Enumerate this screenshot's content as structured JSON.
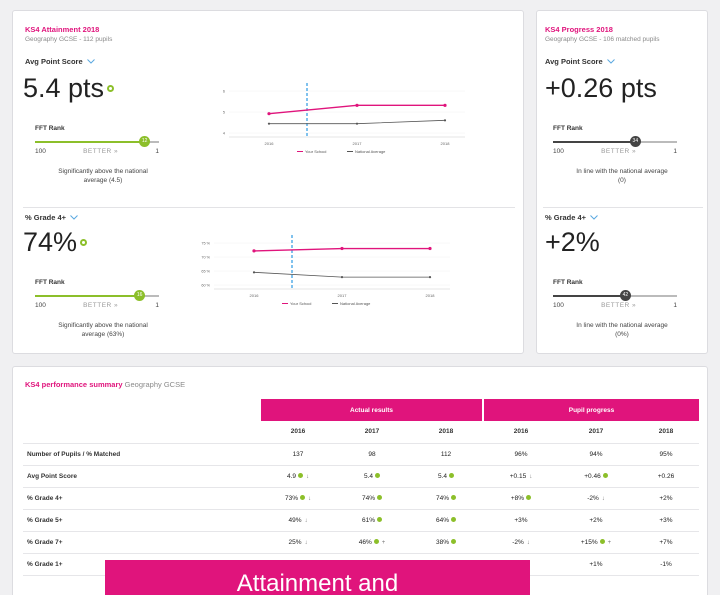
{
  "attainment": {
    "title": "KS4 Attainment 2018",
    "subtitle": "Geography GCSE - 112 pupils",
    "aps": {
      "label": "Avg Point Score",
      "value": "5.4 pts",
      "fft_label": "FFT Rank",
      "scale_left": "100",
      "scale_mid": "BETTER »",
      "scale_right": "1",
      "rank": "12",
      "rank_fraction": 0.88,
      "note_line1": "Significantly above the national",
      "note_line2": "average (4.5)"
    },
    "grade4": {
      "label": "% Grade 4+",
      "value": "74%",
      "fft_label": "FFT Rank",
      "scale_left": "100",
      "scale_mid": "BETTER »",
      "scale_right": "1",
      "rank": "16",
      "rank_fraction": 0.84,
      "note_line1": "Significantly above the national",
      "note_line2": "average (63%)"
    }
  },
  "progress": {
    "title": "KS4 Progress 2018",
    "subtitle": "Geography GCSE - 106 matched pupils",
    "aps": {
      "label": "Avg Point Score",
      "value": "+0.26 pts",
      "fft_label": "FFT Rank",
      "scale_left": "100",
      "scale_mid": "BETTER »",
      "scale_right": "1",
      "rank": "34",
      "rank_fraction": 0.66,
      "note_line1": "In line with the national average",
      "note_line2": "(0)"
    },
    "grade4": {
      "label": "% Grade 4+",
      "value": "+2%",
      "fft_label": "FFT Rank",
      "scale_left": "100",
      "scale_mid": "BETTER »",
      "scale_right": "1",
      "rank": "42",
      "rank_fraction": 0.58,
      "note_line1": "In line with the national average",
      "note_line2": "(0%)"
    }
  },
  "chart_data": [
    {
      "type": "line",
      "x": [
        "2016",
        "2017",
        "2018"
      ],
      "yticks": [
        "6",
        "5",
        "4"
      ],
      "ylim": [
        3.5,
        6.5
      ],
      "series": [
        {
          "name": "Your School",
          "values": [
            4.9,
            5.4,
            5.4
          ],
          "color": "#e0147c"
        },
        {
          "name": "National Average",
          "values": [
            4.3,
            4.3,
            4.5
          ],
          "color": "#555555"
        }
      ],
      "legend": "bottom"
    },
    {
      "type": "line",
      "x": [
        "2016",
        "2017",
        "2018"
      ],
      "yticks": [
        "75 %",
        "70 %",
        "65 %",
        "60 %"
      ],
      "ylim": [
        57,
        78
      ],
      "series": [
        {
          "name": "Your School",
          "values": [
            73,
            74,
            74
          ],
          "color": "#e0147c"
        },
        {
          "name": "National Average",
          "values": [
            64,
            62,
            62
          ],
          "color": "#555555"
        }
      ],
      "legend": "bottom"
    }
  ],
  "summary": {
    "title": "KS4 performance summary",
    "subject": "Geography GCSE",
    "group_actual": "Actual results",
    "group_progress": "Pupil progress",
    "years": [
      "2016",
      "2017",
      "2018",
      "2016",
      "2017",
      "2018"
    ],
    "rows": [
      {
        "label": "Number of Pupils / % Matched",
        "cells": [
          {
            "v": "137",
            "m": ""
          },
          {
            "v": "98",
            "m": ""
          },
          {
            "v": "112",
            "m": ""
          },
          {
            "v": "96%",
            "m": ""
          },
          {
            "v": "94%",
            "m": ""
          },
          {
            "v": "95%",
            "m": ""
          }
        ]
      },
      {
        "label": "Avg Point Score",
        "cells": [
          {
            "v": "4.9",
            "m": "gd"
          },
          {
            "v": "5.4",
            "m": "g"
          },
          {
            "v": "5.4",
            "m": "g"
          },
          {
            "v": "+0.15",
            "m": "d"
          },
          {
            "v": "+0.46",
            "m": "g"
          },
          {
            "v": "+0.26",
            "m": ""
          }
        ]
      },
      {
        "label": "% Grade 4+",
        "cells": [
          {
            "v": "73%",
            "m": "gd"
          },
          {
            "v": "74%",
            "m": "g"
          },
          {
            "v": "74%",
            "m": "g"
          },
          {
            "v": "+8%",
            "m": "g"
          },
          {
            "v": "-2%",
            "m": "d"
          },
          {
            "v": "+2%",
            "m": ""
          }
        ]
      },
      {
        "label": "% Grade 5+",
        "cells": [
          {
            "v": "49%",
            "m": "d"
          },
          {
            "v": "61%",
            "m": "g"
          },
          {
            "v": "64%",
            "m": "g"
          },
          {
            "v": "+3%",
            "m": ""
          },
          {
            "v": "+2%",
            "m": ""
          },
          {
            "v": "+3%",
            "m": ""
          }
        ]
      },
      {
        "label": "% Grade 7+",
        "cells": [
          {
            "v": "25%",
            "m": "d"
          },
          {
            "v": "46%",
            "m": "gu"
          },
          {
            "v": "38%",
            "m": "g"
          },
          {
            "v": "-2%",
            "m": "d"
          },
          {
            "v": "+15%",
            "m": "gu"
          },
          {
            "v": "+7%",
            "m": ""
          }
        ]
      },
      {
        "label": "% Grade 1+",
        "cells": [
          {
            "v": "",
            "m": ""
          },
          {
            "v": "",
            "m": ""
          },
          {
            "v": "",
            "m": ""
          },
          {
            "v": "%",
            "m": ""
          },
          {
            "v": "+1%",
            "m": ""
          },
          {
            "v": "-1%",
            "m": ""
          }
        ]
      }
    ]
  },
  "banner": {
    "text": "Attainment and"
  },
  "colors": {
    "accent": "#e0147c",
    "good": "#8cbf2a",
    "dark": "#444444"
  }
}
